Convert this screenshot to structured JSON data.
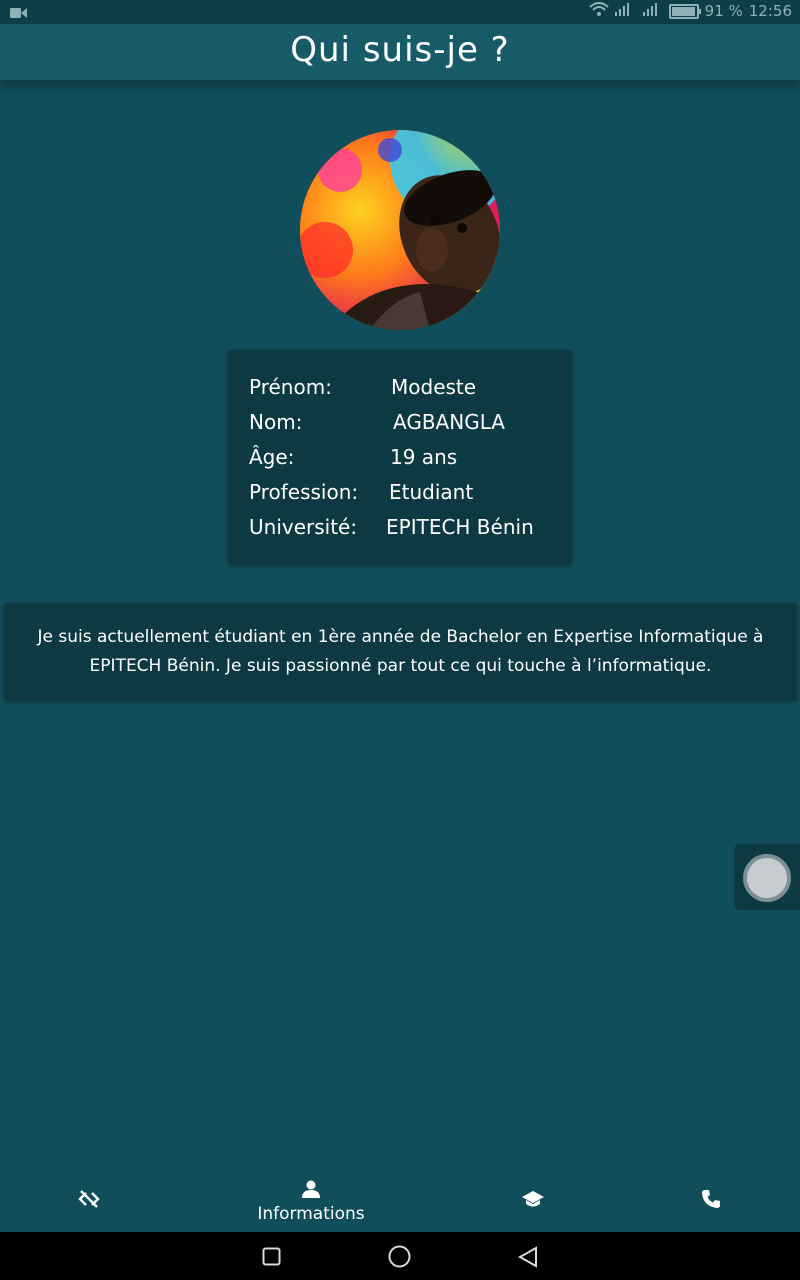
{
  "status_bar": {
    "battery_percent": "91 %",
    "battery_level": 0.91,
    "time": "12:56"
  },
  "app_bar": {
    "title": "Qui suis-je ?"
  },
  "profile": {
    "rows": [
      {
        "label": "Prénom:",
        "value": "Modeste"
      },
      {
        "label": "Nom:",
        "value": "AGBANGLA"
      },
      {
        "label": "Âge:",
        "value": "19 ans"
      },
      {
        "label": "Profession:",
        "value": "Etudiant"
      },
      {
        "label": "Université:",
        "value": "EPITECH Bénin"
      }
    ]
  },
  "bio": {
    "text": "Je suis actuellement étudiant en 1ère année de Bachelor en   Expertise Informatique à EPITECH Bénin. Je suis passionné par tout ce qui touche à l’informatique."
  },
  "bottom_nav": {
    "items": [
      {
        "icon": "code-off-icon",
        "label": ""
      },
      {
        "icon": "person-icon",
        "label": "Informations"
      },
      {
        "icon": "school-icon",
        "label": ""
      },
      {
        "icon": "phone-icon",
        "label": ""
      }
    ],
    "active_index": 1
  },
  "colors": {
    "background": "#114e5b",
    "app_bar": "#175b68",
    "card": "#0d3942",
    "text": "#ffffff"
  }
}
